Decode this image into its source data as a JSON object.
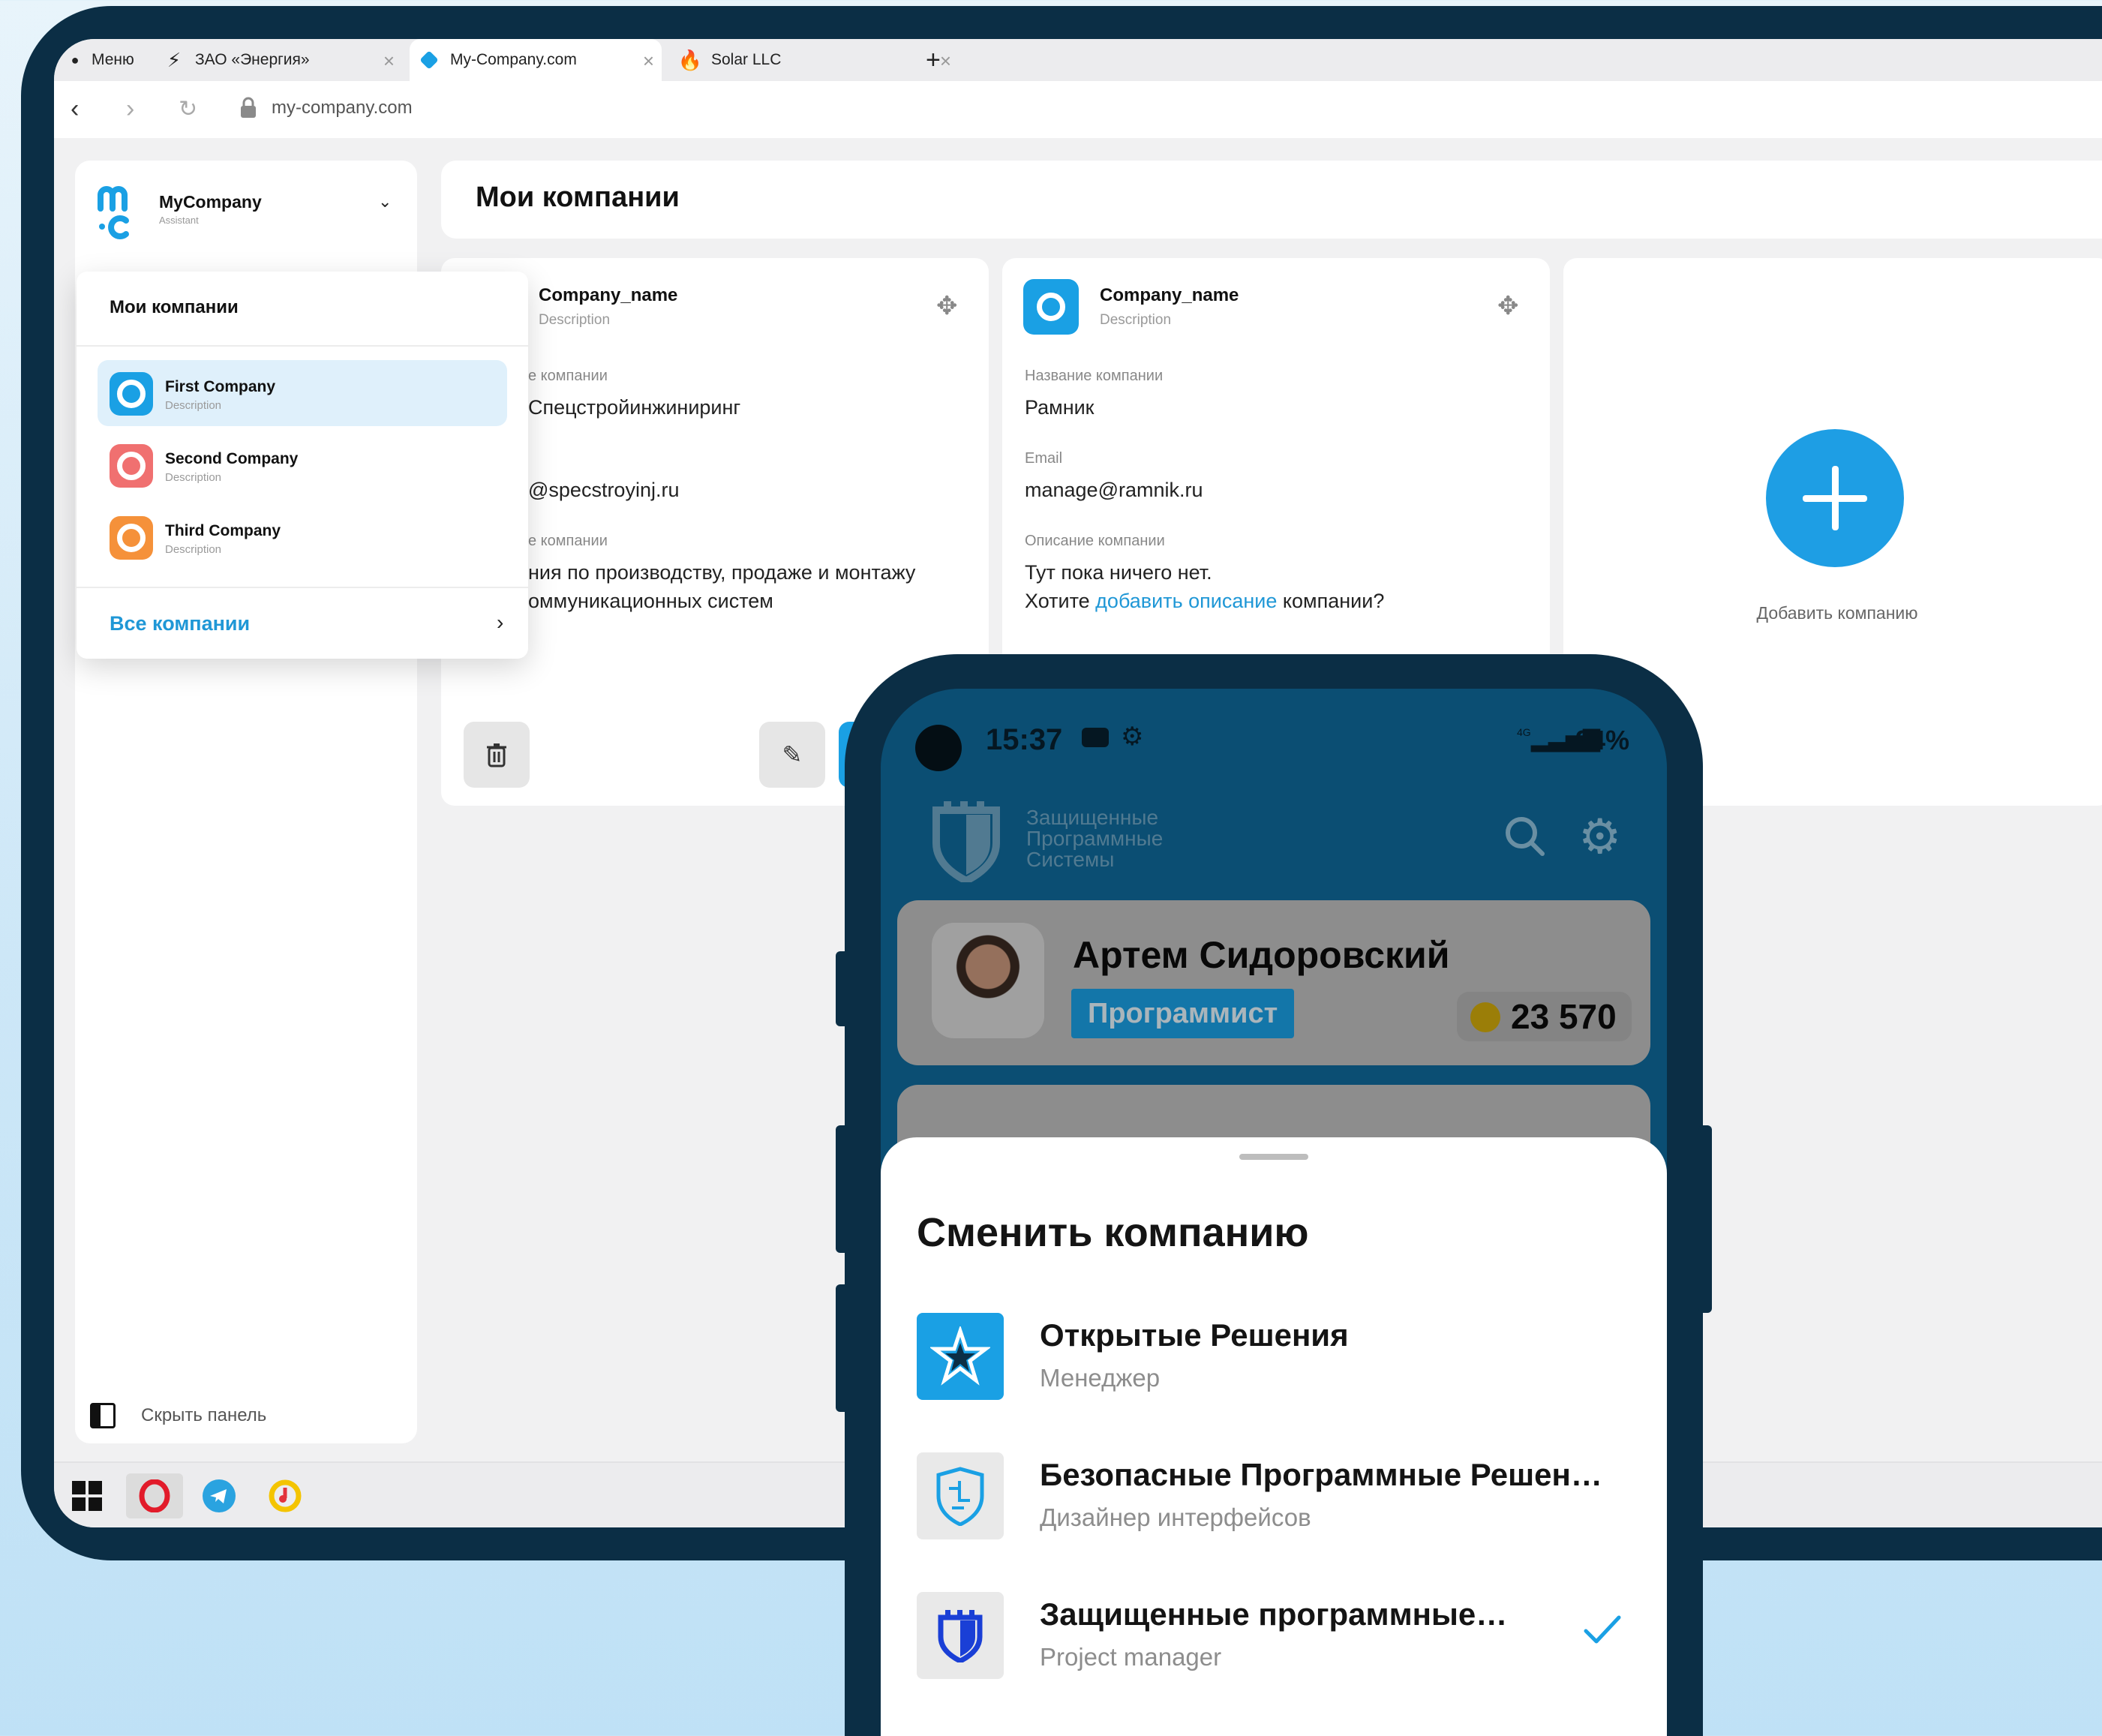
{
  "browser": {
    "tabs": [
      {
        "label": "Меню"
      },
      {
        "label": "ЗАО «Энергия»"
      },
      {
        "label": "My-Company.com"
      },
      {
        "label": "Solar LLC"
      }
    ],
    "new_tab": "+",
    "url": "my-company.com"
  },
  "sidebar": {
    "brand_name": "MyCompany",
    "brand_sub": "Assistant",
    "hide_panel": "Скрыть панель"
  },
  "dropdown": {
    "title": "Мои компании",
    "items": [
      {
        "name": "First Company",
        "desc": "Description",
        "color": "#1aa0e4",
        "selected": true
      },
      {
        "name": "Second Company",
        "desc": "Description",
        "color": "#f07070",
        "selected": false
      },
      {
        "name": "Third Company",
        "desc": "Description",
        "color": "#f5913a",
        "selected": false
      }
    ],
    "all_label": "Все компании",
    "all_chevron": "›"
  },
  "main": {
    "title": "Мои компании",
    "cards": [
      {
        "name": "Company_name",
        "desc": "Description",
        "label1": "е компании",
        "value1": "Спецстройинжиниринг",
        "value2": "@specstroyinj.ru",
        "label3": "е компании",
        "value3a": "ния по производству, продаже и монтажу",
        "value3b": "оммуникационных систем"
      },
      {
        "name": "Company_name",
        "desc": "Description",
        "label1": "Название компании",
        "value1": "Рамник",
        "label2": "Email",
        "value2": "manage@ramnik.ru",
        "label3": "Описание компании",
        "value3a": "Тут пока ничего нет.",
        "value3b_pre": "Хотите ",
        "value3b_link": "добавить описание",
        "value3b_post": " компании?"
      }
    ],
    "add_label": "Добавить компанию"
  },
  "phone": {
    "time": "15:37",
    "network": "4G",
    "battery": "94%",
    "brand_lines": [
      "Защищенные",
      "Программные",
      "Системы"
    ],
    "profile": {
      "name": "Артем Сидоровский",
      "role": "Программист",
      "coins": "23 570"
    },
    "sheet": {
      "title": "Сменить компанию",
      "options": [
        {
          "name": "Открытые Решения",
          "role": "Менеджер",
          "bg": "#1aa0e4"
        },
        {
          "name": "Безопасные Программные Решен…",
          "role": "Дизайнер интерфейсов",
          "bg": "#e9e9e9"
        },
        {
          "name": "Защищенные программные…",
          "role": "Project manager",
          "bg": "#e9e9e9",
          "checked": true
        }
      ]
    }
  },
  "colors": {
    "accent": "#1aa0e4",
    "tablet_frame": "#0b2e45",
    "link": "#1f97d6"
  }
}
